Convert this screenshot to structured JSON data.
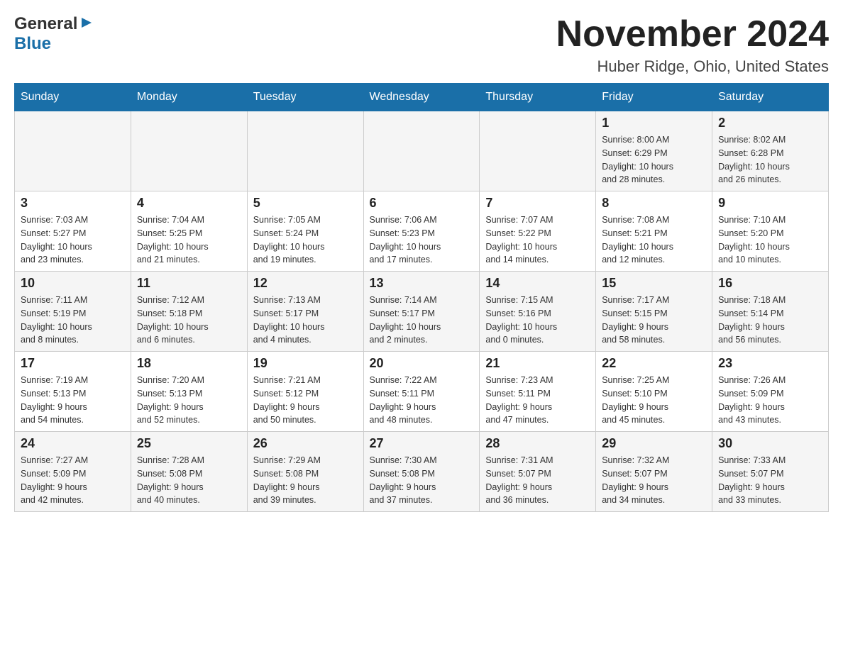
{
  "header": {
    "logo_general": "General",
    "logo_blue": "Blue",
    "month_title": "November 2024",
    "location": "Huber Ridge, Ohio, United States"
  },
  "calendar": {
    "days_of_week": [
      "Sunday",
      "Monday",
      "Tuesday",
      "Wednesday",
      "Thursday",
      "Friday",
      "Saturday"
    ],
    "weeks": [
      [
        {
          "day": "",
          "info": ""
        },
        {
          "day": "",
          "info": ""
        },
        {
          "day": "",
          "info": ""
        },
        {
          "day": "",
          "info": ""
        },
        {
          "day": "",
          "info": ""
        },
        {
          "day": "1",
          "info": "Sunrise: 8:00 AM\nSunset: 6:29 PM\nDaylight: 10 hours\nand 28 minutes."
        },
        {
          "day": "2",
          "info": "Sunrise: 8:02 AM\nSunset: 6:28 PM\nDaylight: 10 hours\nand 26 minutes."
        }
      ],
      [
        {
          "day": "3",
          "info": "Sunrise: 7:03 AM\nSunset: 5:27 PM\nDaylight: 10 hours\nand 23 minutes."
        },
        {
          "day": "4",
          "info": "Sunrise: 7:04 AM\nSunset: 5:25 PM\nDaylight: 10 hours\nand 21 minutes."
        },
        {
          "day": "5",
          "info": "Sunrise: 7:05 AM\nSunset: 5:24 PM\nDaylight: 10 hours\nand 19 minutes."
        },
        {
          "day": "6",
          "info": "Sunrise: 7:06 AM\nSunset: 5:23 PM\nDaylight: 10 hours\nand 17 minutes."
        },
        {
          "day": "7",
          "info": "Sunrise: 7:07 AM\nSunset: 5:22 PM\nDaylight: 10 hours\nand 14 minutes."
        },
        {
          "day": "8",
          "info": "Sunrise: 7:08 AM\nSunset: 5:21 PM\nDaylight: 10 hours\nand 12 minutes."
        },
        {
          "day": "9",
          "info": "Sunrise: 7:10 AM\nSunset: 5:20 PM\nDaylight: 10 hours\nand 10 minutes."
        }
      ],
      [
        {
          "day": "10",
          "info": "Sunrise: 7:11 AM\nSunset: 5:19 PM\nDaylight: 10 hours\nand 8 minutes."
        },
        {
          "day": "11",
          "info": "Sunrise: 7:12 AM\nSunset: 5:18 PM\nDaylight: 10 hours\nand 6 minutes."
        },
        {
          "day": "12",
          "info": "Sunrise: 7:13 AM\nSunset: 5:17 PM\nDaylight: 10 hours\nand 4 minutes."
        },
        {
          "day": "13",
          "info": "Sunrise: 7:14 AM\nSunset: 5:17 PM\nDaylight: 10 hours\nand 2 minutes."
        },
        {
          "day": "14",
          "info": "Sunrise: 7:15 AM\nSunset: 5:16 PM\nDaylight: 10 hours\nand 0 minutes."
        },
        {
          "day": "15",
          "info": "Sunrise: 7:17 AM\nSunset: 5:15 PM\nDaylight: 9 hours\nand 58 minutes."
        },
        {
          "day": "16",
          "info": "Sunrise: 7:18 AM\nSunset: 5:14 PM\nDaylight: 9 hours\nand 56 minutes."
        }
      ],
      [
        {
          "day": "17",
          "info": "Sunrise: 7:19 AM\nSunset: 5:13 PM\nDaylight: 9 hours\nand 54 minutes."
        },
        {
          "day": "18",
          "info": "Sunrise: 7:20 AM\nSunset: 5:13 PM\nDaylight: 9 hours\nand 52 minutes."
        },
        {
          "day": "19",
          "info": "Sunrise: 7:21 AM\nSunset: 5:12 PM\nDaylight: 9 hours\nand 50 minutes."
        },
        {
          "day": "20",
          "info": "Sunrise: 7:22 AM\nSunset: 5:11 PM\nDaylight: 9 hours\nand 48 minutes."
        },
        {
          "day": "21",
          "info": "Sunrise: 7:23 AM\nSunset: 5:11 PM\nDaylight: 9 hours\nand 47 minutes."
        },
        {
          "day": "22",
          "info": "Sunrise: 7:25 AM\nSunset: 5:10 PM\nDaylight: 9 hours\nand 45 minutes."
        },
        {
          "day": "23",
          "info": "Sunrise: 7:26 AM\nSunset: 5:09 PM\nDaylight: 9 hours\nand 43 minutes."
        }
      ],
      [
        {
          "day": "24",
          "info": "Sunrise: 7:27 AM\nSunset: 5:09 PM\nDaylight: 9 hours\nand 42 minutes."
        },
        {
          "day": "25",
          "info": "Sunrise: 7:28 AM\nSunset: 5:08 PM\nDaylight: 9 hours\nand 40 minutes."
        },
        {
          "day": "26",
          "info": "Sunrise: 7:29 AM\nSunset: 5:08 PM\nDaylight: 9 hours\nand 39 minutes."
        },
        {
          "day": "27",
          "info": "Sunrise: 7:30 AM\nSunset: 5:08 PM\nDaylight: 9 hours\nand 37 minutes."
        },
        {
          "day": "28",
          "info": "Sunrise: 7:31 AM\nSunset: 5:07 PM\nDaylight: 9 hours\nand 36 minutes."
        },
        {
          "day": "29",
          "info": "Sunrise: 7:32 AM\nSunset: 5:07 PM\nDaylight: 9 hours\nand 34 minutes."
        },
        {
          "day": "30",
          "info": "Sunrise: 7:33 AM\nSunset: 5:07 PM\nDaylight: 9 hours\nand 33 minutes."
        }
      ]
    ]
  }
}
